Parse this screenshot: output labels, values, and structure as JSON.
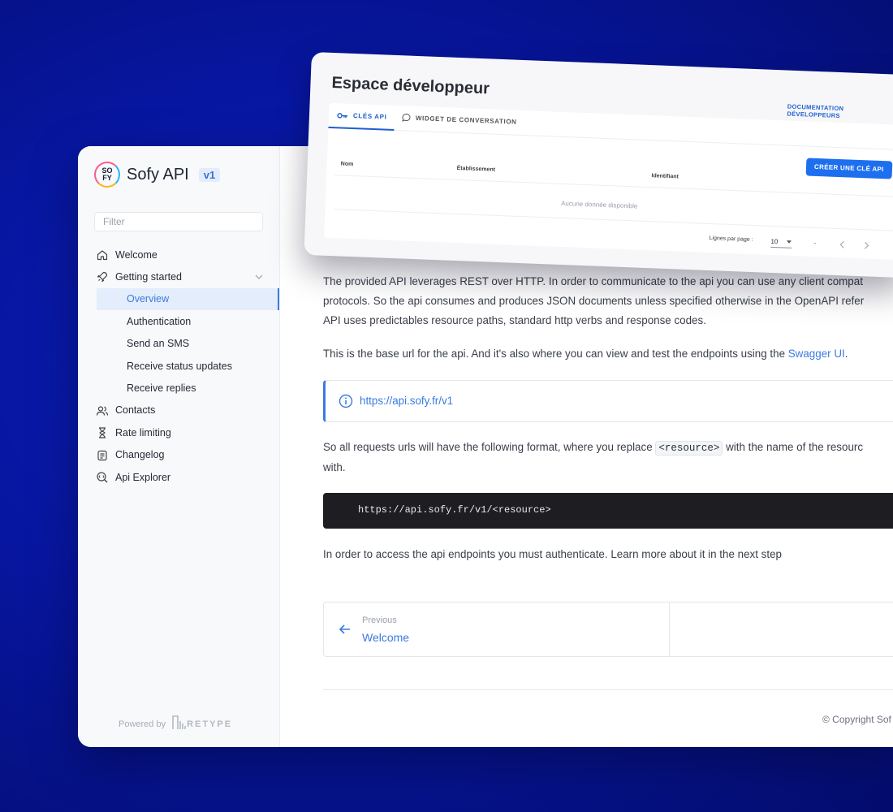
{
  "sidebar": {
    "brand_logo_line1": "SO",
    "brand_logo_line2": "FY",
    "brand_name": "Sofy API",
    "version": "v1",
    "filter_placeholder": "Filter",
    "items": [
      {
        "label": "Welcome",
        "icon": "home-icon"
      },
      {
        "label": "Getting started",
        "icon": "rocket-icon"
      },
      {
        "label": "Overview",
        "sub": true,
        "active": true
      },
      {
        "label": "Authentication",
        "sub": true
      },
      {
        "label": "Send an SMS",
        "sub": true
      },
      {
        "label": "Receive status updates",
        "sub": true
      },
      {
        "label": "Receive replies",
        "sub": true
      },
      {
        "label": "Contacts",
        "icon": "people-icon"
      },
      {
        "label": "Rate limiting",
        "icon": "hourglass-icon"
      },
      {
        "label": "Changelog",
        "icon": "changelog-icon"
      },
      {
        "label": "Api Explorer",
        "icon": "explorer-icon"
      }
    ],
    "powered_by": "Powered by",
    "retype": "RETYPE"
  },
  "content": {
    "para1_line1": "The provided API leverages REST over HTTP. In order to communicate to the api you can use any client compat",
    "para1_line2": "protocols. So the api consumes and produces JSON documents unless specified otherwise in the OpenAPI refer",
    "para1_line3": "API uses predictables resource paths, standard http verbs and response codes.",
    "para2_text": "This is the base url for the api. And it's also where you can view and test the endpoints using the ",
    "para2_link": "Swagger UI",
    "para2_end": ".",
    "callout_url": "https://api.sofy.fr/v1",
    "para3_start": "So all requests urls will have the following format, where you replace ",
    "para3_code": "<resource>",
    "para3_end": " with the name of the resourc",
    "para3_line2": "with.",
    "code_block": "https://api.sofy.fr/v1/<resource>",
    "para4": "In order to access the api endpoints you must authenticate. Learn more about it in the next step",
    "pager_prev_label": "Previous",
    "pager_prev_title": "Welcome",
    "copyright": "© Copyright Sof"
  },
  "dev_card": {
    "title": "Espace développeur",
    "doc_link": "DOCUMENTATION DÉVELOPPEURS",
    "tab_api_keys": "CLÉS API",
    "tab_widget": "WIDGET DE CONVERSATION",
    "create_button": "CRÉER UNE CLÉ API",
    "col_name": "Nom",
    "col_establishment": "Établissement",
    "col_identifier": "Identifiant",
    "empty_message": "Aucune donnée disponible",
    "rows_per_page_label": "Lignes par page :",
    "rows_per_page_value": "10",
    "pagination_text": "-"
  },
  "colors": {
    "accent": "#3b7ae0",
    "card_accent": "#1d6ff0",
    "background": "#0716a0"
  }
}
